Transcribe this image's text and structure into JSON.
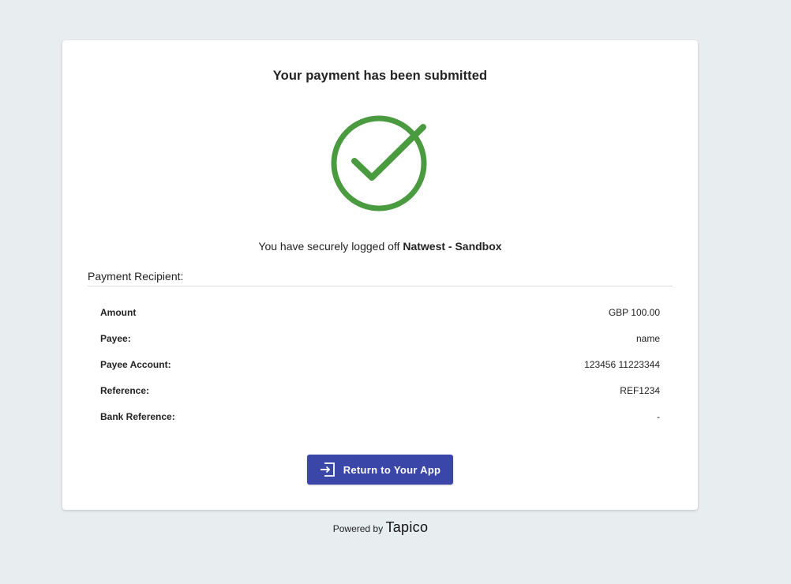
{
  "card": {
    "title": "Your payment has been submitted",
    "logoff_prefix": "You have securely logged off ",
    "bank_name": "Natwest - Sandbox",
    "recipient_label": "Payment Recipient:",
    "details": [
      {
        "key": "Amount",
        "value": "GBP 100.00"
      },
      {
        "key": "Payee:",
        "value": "name"
      },
      {
        "key": "Payee Account:",
        "value": "123456 11223344"
      },
      {
        "key": "Reference:",
        "value": "REF1234"
      },
      {
        "key": "Bank Reference:",
        "value": "-"
      }
    ],
    "button_label": "Return to Your App",
    "button_icon": "exit-icon"
  },
  "footer": {
    "powered_by": "Powered by",
    "brand": "Tapico"
  },
  "colors": {
    "success": "#4a9a3f",
    "primary_button": "#3a46a8",
    "background": "#e8edf0"
  }
}
